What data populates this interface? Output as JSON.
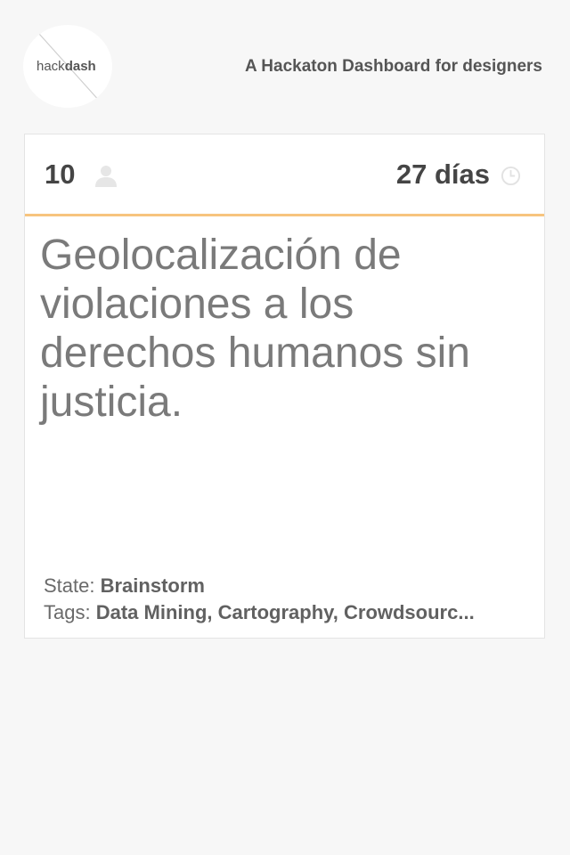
{
  "header": {
    "logo_hack": "hack",
    "logo_dash": "dash",
    "tagline": "A Hackaton Dashboard for designers"
  },
  "project": {
    "followers": "10",
    "time_left": "27 días",
    "title": "Geolocalización de violaciones a los derechos humanos sin justicia.",
    "state_label": "State:",
    "state_value": "Brainstorm",
    "tags_label": "Tags:",
    "tags_value": "Data Mining, Cartography, Crowdsourc..."
  },
  "icons": {
    "user": "user-icon",
    "clock": "clock-icon"
  },
  "colors": {
    "page_bg": "#f7f7f7",
    "card_bg": "#ffffff",
    "accent": "#f7c47e",
    "text_dark": "#454545",
    "text_title": "#7a7a7a"
  }
}
